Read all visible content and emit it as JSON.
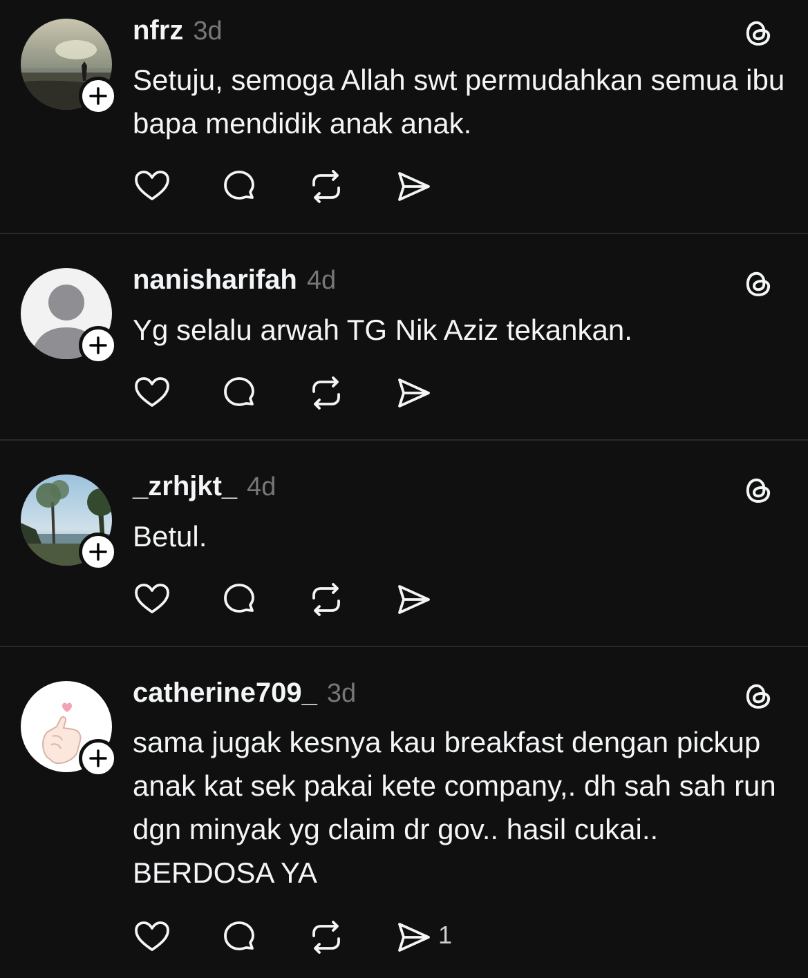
{
  "posts": [
    {
      "username": "nfrz",
      "time": "3d",
      "text": "Setuju, semoga Allah swt permudahkan semua ibu bapa mendidik anak anak.",
      "avatar": "beach-sunset-photo",
      "share_count": ""
    },
    {
      "username": "nanisharifah",
      "time": "4d",
      "text": "Yg selalu arwah TG Nik Aziz tekankan.",
      "avatar": "default-person-silhouette",
      "share_count": ""
    },
    {
      "username": "_zrhjkt_",
      "time": "4d",
      "text": "Betul.",
      "avatar": "tree-lake-photo",
      "share_count": ""
    },
    {
      "username": "catherine709_",
      "time": "3d",
      "text": "sama jugak kesnya kau breakfast dengan pickup anak kat sek pakai kete company,. dh sah sah run dgn minyak yg claim dr gov.. hasil cukai.. BERDOSA YA",
      "avatar": "finger-heart-illustration",
      "share_count": "1"
    }
  ],
  "icons": {
    "like": "heart-icon",
    "reply": "comment-icon",
    "repost": "repost-icon",
    "share": "send-icon",
    "app": "threads-logo-icon",
    "follow": "plus-icon"
  },
  "colors": {
    "background": "#101010",
    "text": "#f3f5f7",
    "muted": "#777777",
    "divider": "#2a2a2a"
  }
}
